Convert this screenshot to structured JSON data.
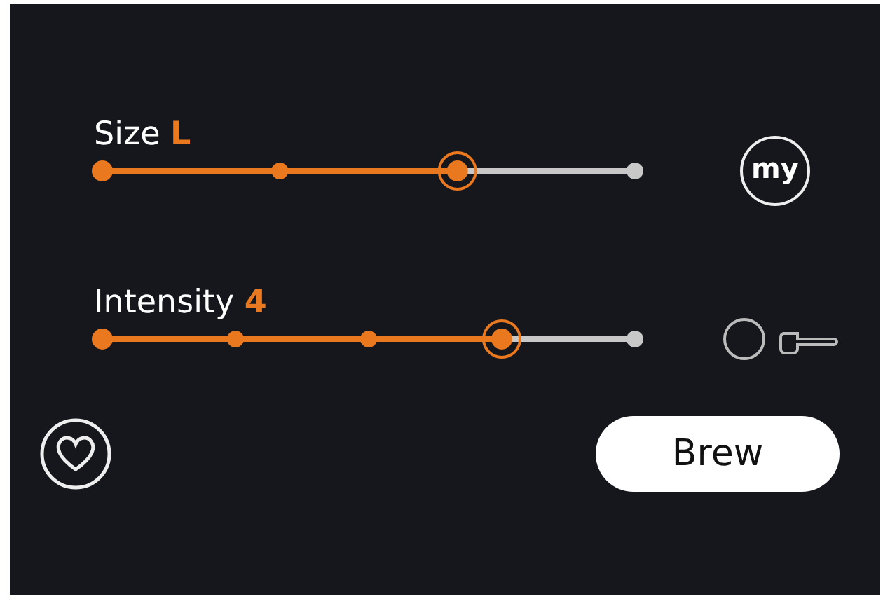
{
  "sliders": [
    {
      "label": "Size",
      "value": "L",
      "stops": [
        {
          "selected": false
        },
        {
          "selected": false
        },
        {
          "selected": true
        },
        {
          "selected": false
        }
      ]
    },
    {
      "label": "Intensity",
      "value": "4",
      "stops": [
        {
          "selected": false
        },
        {
          "selected": false
        },
        {
          "selected": false
        },
        {
          "selected": true
        },
        {
          "selected": false
        }
      ]
    }
  ],
  "my_button": {
    "label": "my"
  },
  "brew_button": {
    "label": "Brew"
  }
}
